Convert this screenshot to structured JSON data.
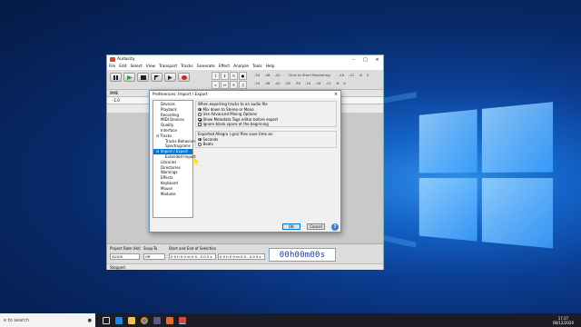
{
  "app": {
    "title": "Audacity",
    "menu": [
      "File",
      "Edit",
      "Select",
      "View",
      "Transport",
      "Tracks",
      "Generate",
      "Effect",
      "Analyze",
      "Tools",
      "Help"
    ],
    "meter_click": "Click to Start Monitoring",
    "meter_ticks_top": [
      "-54",
      "-48",
      "-42",
      "-18",
      "-12",
      "-6",
      "0"
    ],
    "meter_ticks_bottom": [
      "-54",
      "-48",
      "-42",
      "-36",
      "-30",
      "-24",
      "-18",
      "-12",
      "-6",
      "0"
    ],
    "host": "MME",
    "ruler": [
      "-1.0",
      "0.0",
      "1.0"
    ],
    "project_rate_label": "Project Rate (Hz)",
    "project_rate_value": "44100",
    "snap_to_label": "Snap-To",
    "snap_to_value": "Off",
    "selection_label": "Start and End of Selection",
    "sel_start": "0 0 h 0 0 m 0 0 . 0 0 0 s",
    "sel_end": "0 0 h 0 0 m 0 0 . 0 0 0 s",
    "big_time": "00h00m00s",
    "status": "Stopped."
  },
  "dialog": {
    "title": "Preferences: Import / Export",
    "tree": [
      "Devices",
      "Playback",
      "Recording",
      "MIDI Devices",
      "Quality",
      "Interface",
      "Tracks",
      "Tracks Behaviors",
      "Spectrograms",
      "Import / Export",
      "Extended Import",
      "Libraries",
      "Directories",
      "Warnings",
      "Effects",
      "Keyboard",
      "Mouse",
      "Modules"
    ],
    "group1_heading": "When exporting tracks to an audio file",
    "opt_mix": "Mix down to Stereo or Mono",
    "opt_advanced": "Use Advanced Mixing Options",
    "opt_metadata": "Show Metadata Tags editor before export",
    "opt_blank": "Ignore blank space at the beginning",
    "group2_heading": "Exported Allegro (.gro) files save time as:",
    "opt_seconds": "Seconds",
    "opt_beats": "Beats",
    "ok": "OK",
    "cancel": "Cancel",
    "help": "?"
  },
  "taskbar": {
    "search_placeholder": "e to search",
    "time": "17:27",
    "date": "06/12/2020"
  }
}
